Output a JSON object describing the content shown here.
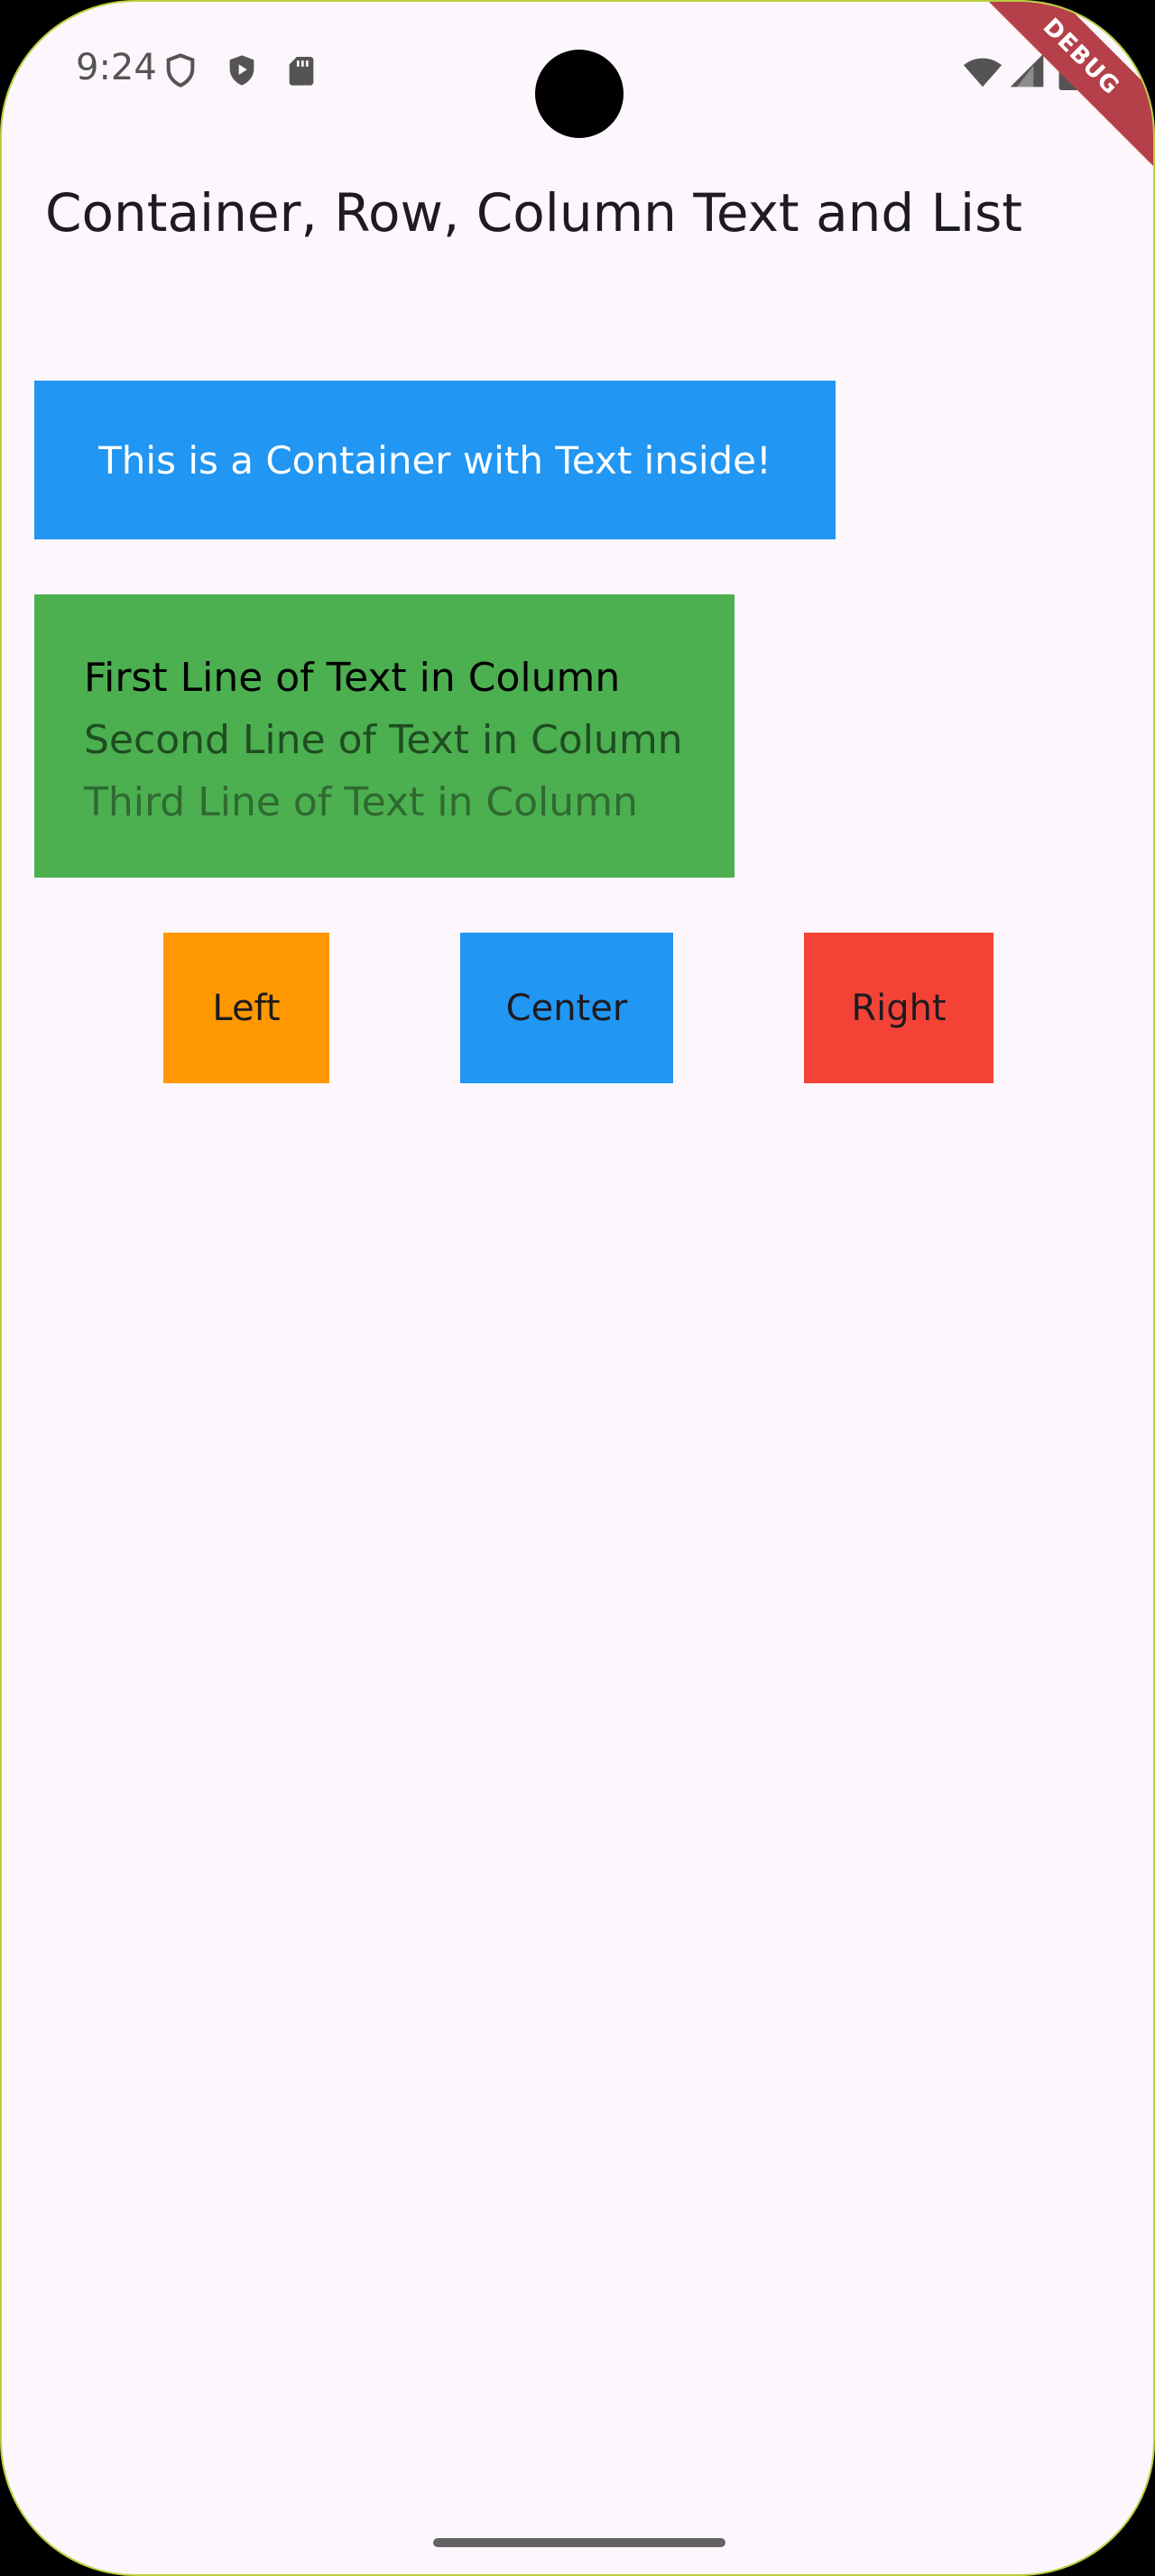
{
  "status_bar": {
    "time": "9:24",
    "left_icons": [
      "shield-icon",
      "play-protect-icon",
      "sd-card-icon"
    ],
    "right_icons": [
      "wifi-icon",
      "signal-icon",
      "battery-icon"
    ]
  },
  "debug_banner": "DEBUG",
  "app_bar": {
    "title": "Container, Row, Column Text and List"
  },
  "container": {
    "text": "This is a Container with Text inside!",
    "color": "#2196f3"
  },
  "column": {
    "color": "#4caf50",
    "lines": [
      "First Line of Text in Column",
      "Second Line of Text in Column",
      "Third Line of Text in Column"
    ]
  },
  "row": {
    "items": [
      {
        "label": "Left",
        "color": "#ff9800"
      },
      {
        "label": "Center",
        "color": "#2196f3"
      },
      {
        "label": "Right",
        "color": "#f44336"
      }
    ]
  }
}
